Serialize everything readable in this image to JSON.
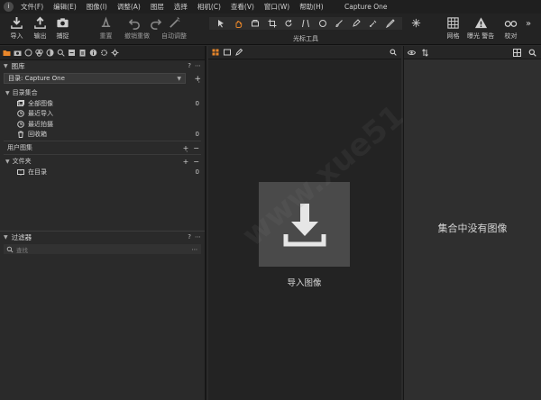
{
  "window": {
    "title": "Capture One"
  },
  "menubar": {
    "items": [
      "文件(F)",
      "编辑(E)",
      "图像(I)",
      "调整(A)",
      "图层",
      "选择",
      "相机(C)",
      "查看(V)",
      "窗口(W)",
      "帮助(H)"
    ]
  },
  "toolbar": {
    "import": "导入",
    "export": "输出",
    "capture": "捕捉",
    "reset": "重置",
    "undo_redo": "撤销重做",
    "auto_adjust": "自动调整",
    "cursor_tools_label": "光标工具",
    "grid": "网格",
    "exposure_warning": "曝光 警告",
    "proof": "校对"
  },
  "library": {
    "title": "图库",
    "catalog_select": "目录: Capture One",
    "catalog_collections": "目录集合",
    "items": [
      {
        "label": "全部图像",
        "count": "0"
      },
      {
        "label": "最近导入",
        "count": ""
      },
      {
        "label": "最近拍摄",
        "count": ""
      },
      {
        "label": "回收箱",
        "count": "0"
      }
    ],
    "user_collections": "用户图集",
    "folders": "文件夹",
    "in_catalog": "在目录",
    "in_catalog_count": "0"
  },
  "filters": {
    "title": "过滤器",
    "search_placeholder": "查找"
  },
  "viewer": {
    "import_label": "导入图像"
  },
  "browser": {
    "empty_message": "集合中没有图像"
  },
  "colors": {
    "accent": "#e8862a",
    "panel_bg": "#2a2a2a",
    "import_box": "#4a4a4a"
  }
}
